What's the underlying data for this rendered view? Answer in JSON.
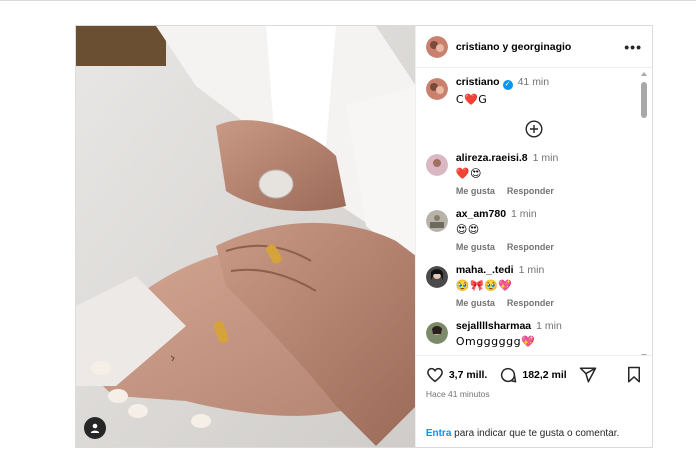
{
  "header": {
    "account_names": "cristiano y georginagio",
    "more_label": "•••"
  },
  "caption": {
    "username": "cristiano",
    "time": "41 min",
    "text": "C❤️G"
  },
  "load_more_label": "+",
  "comments": [
    {
      "username": "alireza.raeisi.8",
      "time": "1 min",
      "text": "❤️😍",
      "like_label": "Me gusta",
      "reply_label": "Responder"
    },
    {
      "username": "ax_am780",
      "time": "1 min",
      "text": "😍😍",
      "like_label": "Me gusta",
      "reply_label": "Responder"
    },
    {
      "username": "maha._.tedi",
      "time": "1 min",
      "text": "🥹🎀🥹💖",
      "like_label": "Me gusta",
      "reply_label": "Responder"
    },
    {
      "username": "sejallllsharmaa",
      "time": "1 min",
      "text": "Omgggggg💖"
    }
  ],
  "stats": {
    "likes": "3,7 mill.",
    "comments": "182,2 mil",
    "posted_ago": "Hace 41 minutos"
  },
  "login_prompt": {
    "link": "Entra",
    "text": " para indicar que te gusta o comentar."
  },
  "colors": {
    "accent_blue": "#0095f6",
    "heart_red": "#e0245e"
  },
  "icons": [
    "user-tag-icon",
    "more-options-icon",
    "verified-badge-icon",
    "add-circle-icon",
    "heart-icon",
    "comment-icon",
    "share-icon",
    "bookmark-icon"
  ]
}
